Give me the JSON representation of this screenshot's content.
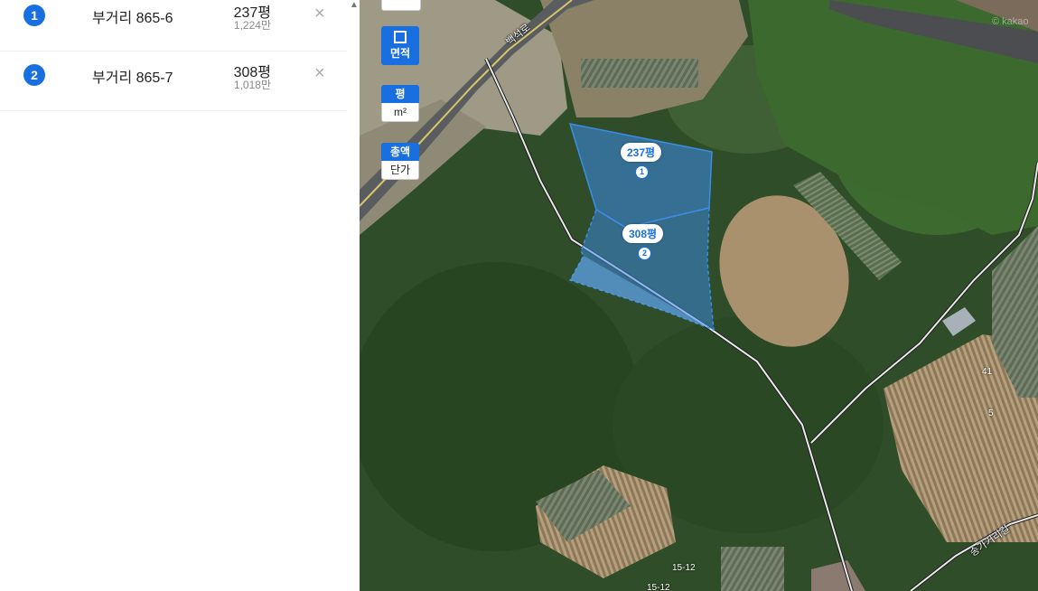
{
  "parcels": [
    {
      "num": "1",
      "address": "부거리 865-6",
      "area": "237평",
      "price": "1,224만",
      "close": "×"
    },
    {
      "num": "2",
      "address": "부거리 865-7",
      "area": "308평",
      "price": "1,018만",
      "close": "×"
    }
  ],
  "toolbar": {
    "area_tool_label": "면적",
    "unit_on": "평",
    "unit_off": "m²",
    "price_on": "총액",
    "price_off": "단가"
  },
  "map": {
    "labels": [
      {
        "text": "237평",
        "num": "1"
      },
      {
        "text": "308평",
        "num": "2"
      }
    ],
    "road_1": "백석로",
    "road_2": "송가거리길",
    "lot_1": "41",
    "lot_2": "5",
    "lot_3": "15-12",
    "lot_4": "15-12",
    "watermark": "© kakao",
    "highlight_color": "#1a6fe0"
  }
}
